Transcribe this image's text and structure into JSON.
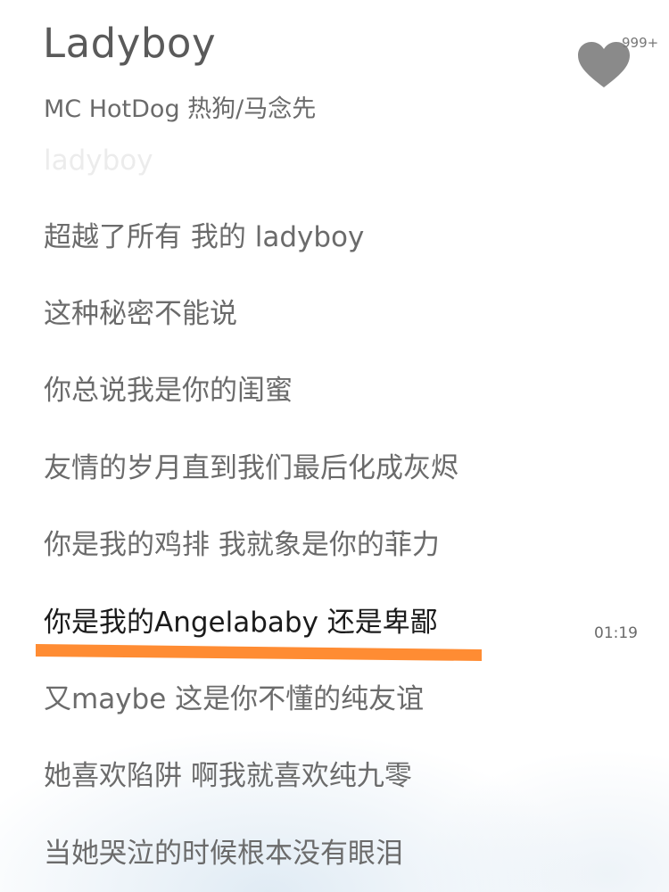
{
  "song": {
    "title": "Ladyboy",
    "artist": "MC HotDog 热狗/马念先"
  },
  "like": {
    "icon": "heart-icon",
    "count": "999+",
    "color": "#8a8a8a"
  },
  "lyrics": [
    {
      "text": "ladyboy",
      "state": "faded"
    },
    {
      "text": "超越了所有 我的 ladyboy",
      "state": "normal"
    },
    {
      "text": "这种秘密不能说",
      "state": "normal"
    },
    {
      "text": "你总说我是你的闺蜜",
      "state": "normal"
    },
    {
      "text": "友情的岁月直到我们最后化成灰烬",
      "state": "normal"
    },
    {
      "text": "你是我的鸡排 我就象是你的菲力",
      "state": "normal"
    },
    {
      "text": "你是我的Angelababy 还是卑鄙",
      "state": "current"
    },
    {
      "text": "又maybe 这是你不懂的纯友谊",
      "state": "normal"
    },
    {
      "text": "她喜欢陷阱 啊我就喜欢纯九零",
      "state": "normal"
    },
    {
      "text": "当她哭泣的时候根本没有眼泪",
      "state": "normal"
    }
  ],
  "current_line_time": "01:19",
  "colors": {
    "highlight_marker": "#FF8C33"
  }
}
